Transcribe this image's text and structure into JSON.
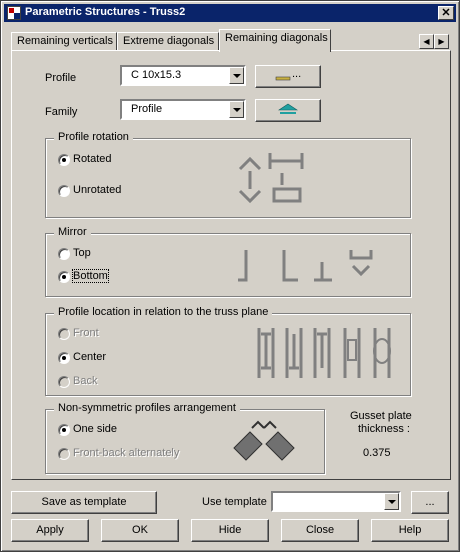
{
  "window": {
    "title": "Parametric Structures - Truss2",
    "close_glyph": "✕"
  },
  "tabs": [
    {
      "label": "Remaining verticals",
      "active": false
    },
    {
      "label": "Extreme diagonals",
      "active": false
    },
    {
      "label": "Remaining diagonals",
      "active": true
    }
  ],
  "tab_scroll": {
    "left": "◀",
    "right": "▶"
  },
  "profile": {
    "label": "Profile",
    "value": "C 10x15.3",
    "button_label": "..."
  },
  "family": {
    "label": "Family",
    "value": "Profile"
  },
  "profile_rotation": {
    "title": "Profile rotation",
    "options": [
      {
        "label": "Rotated",
        "checked": true,
        "enabled": true
      },
      {
        "label": "Unrotated",
        "checked": false,
        "enabled": true
      }
    ]
  },
  "mirror": {
    "title": "Mirror",
    "options": [
      {
        "label": "Top",
        "checked": false,
        "enabled": true
      },
      {
        "label": "Bottom",
        "checked": true,
        "enabled": true
      }
    ]
  },
  "profile_location": {
    "title": "Profile location in relation to the truss plane",
    "options": [
      {
        "label": "Front",
        "checked": false,
        "enabled": false
      },
      {
        "label": "Center",
        "checked": true,
        "enabled": true
      },
      {
        "label": "Back",
        "checked": false,
        "enabled": false
      }
    ]
  },
  "nonsymmetric": {
    "title": "Non-symmetric profiles arrangement",
    "options": [
      {
        "label": "One side",
        "checked": true,
        "enabled": true
      },
      {
        "label": "Front-back alternately",
        "checked": false,
        "enabled": false
      }
    ]
  },
  "gusset": {
    "label_line1": "Gusset plate",
    "label_line2": "thickness :",
    "value": "0.375"
  },
  "footer": {
    "save_template": "Save as template",
    "use_template_label": "Use template",
    "use_template_value": "",
    "browse": "...",
    "apply": "Apply",
    "ok": "OK",
    "hide": "Hide",
    "close": "Close",
    "help": "Help"
  },
  "colors": {
    "titlebar": "#0a246a",
    "face": "#d4d0c8",
    "icon_grey": "#808080",
    "family_icon": "#20a0a0"
  }
}
